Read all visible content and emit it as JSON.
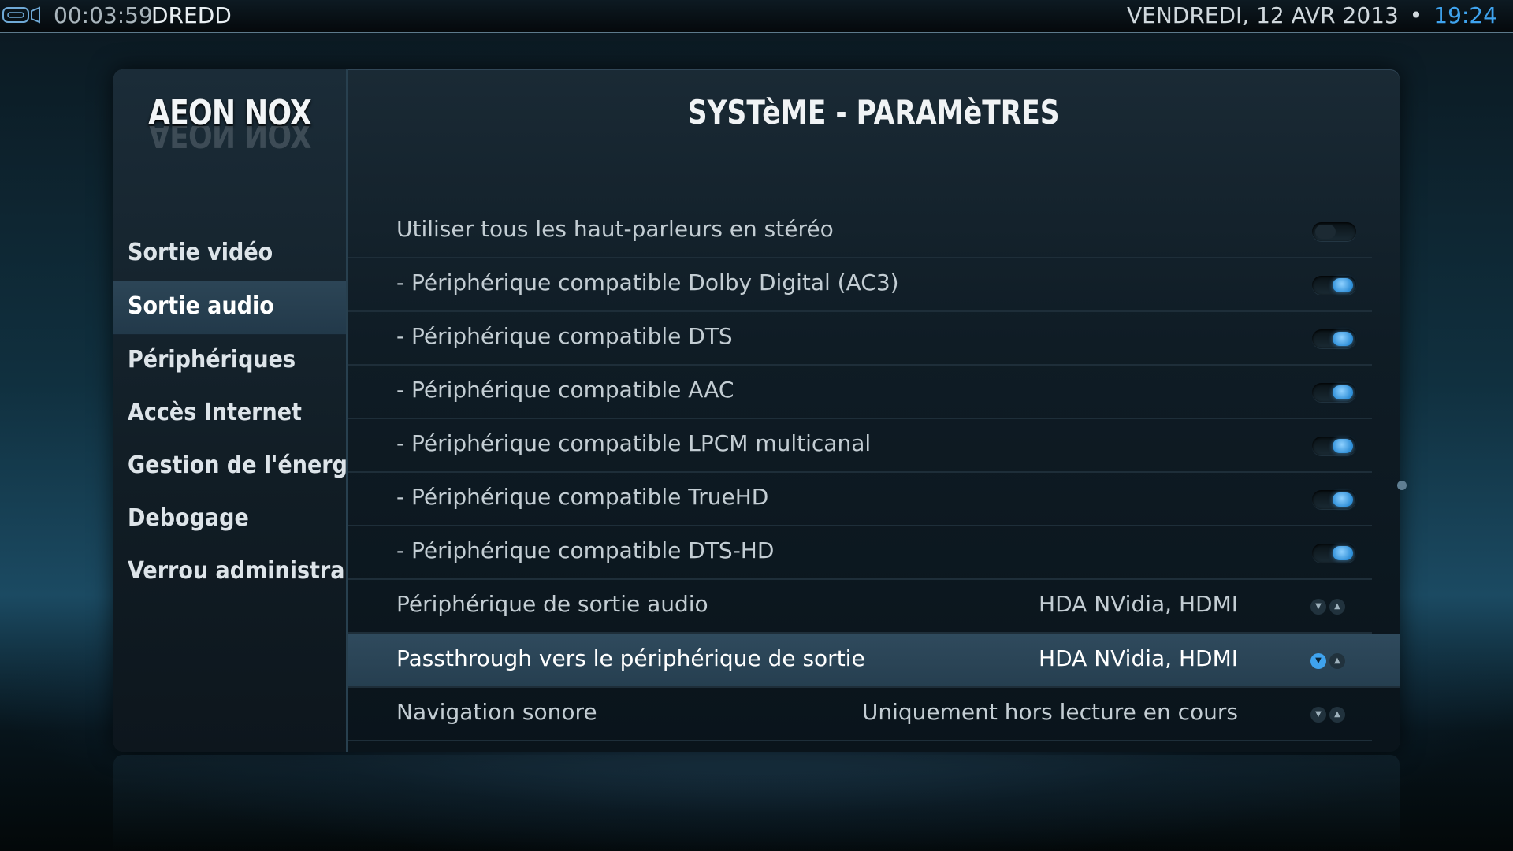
{
  "topbar": {
    "elapsed": "00:03:59",
    "media_title": "DREDD",
    "date": "VENDREDI, 12 AVR 2013",
    "separator": "•",
    "clock": "19:24"
  },
  "sidebar": {
    "logo": "AEON NOX",
    "items": [
      {
        "label": "Sortie vidéo",
        "active": false
      },
      {
        "label": "Sortie audio",
        "active": true
      },
      {
        "label": "Périphériques",
        "active": false
      },
      {
        "label": "Accès Internet",
        "active": false
      },
      {
        "label": "Gestion de l'énergie",
        "active": false
      },
      {
        "label": "Debogage",
        "active": false
      },
      {
        "label": "Verrou administra...",
        "active": false
      }
    ]
  },
  "main": {
    "title": "SYSTèME - PARAMèTRES",
    "settings": [
      {
        "label": "Utiliser tous les haut-parleurs en stéréo",
        "type": "toggle",
        "state": "off"
      },
      {
        "label": "- Périphérique compatible Dolby Digital (AC3)",
        "type": "toggle",
        "state": "on"
      },
      {
        "label": "- Périphérique compatible DTS",
        "type": "toggle",
        "state": "on"
      },
      {
        "label": "- Périphérique compatible AAC",
        "type": "toggle",
        "state": "on"
      },
      {
        "label": "- Périphérique compatible LPCM multicanal",
        "type": "toggle",
        "state": "on"
      },
      {
        "label": "- Périphérique compatible TrueHD",
        "type": "toggle",
        "state": "on"
      },
      {
        "label": "- Périphérique compatible DTS-HD",
        "type": "toggle",
        "state": "on"
      },
      {
        "label": "Périphérique de sortie audio",
        "type": "spinner",
        "value": "HDA NVidia, HDMI"
      },
      {
        "label": "Passthrough vers le périphérique de sortie",
        "type": "spinner",
        "value": "HDA NVidia, HDMI",
        "selected": true
      },
      {
        "label": "Navigation sonore",
        "type": "spinner",
        "value": "Uniquement hors lecture en cours"
      }
    ]
  },
  "colors": {
    "accent": "#3fa3ee",
    "selected_row": "#2f4a5d",
    "text": "#c3cdd3"
  },
  "icons": {
    "topbar_left": "media-playback-icon",
    "spinner_down": "chevron-down-icon",
    "spinner_up": "chevron-up-icon"
  }
}
